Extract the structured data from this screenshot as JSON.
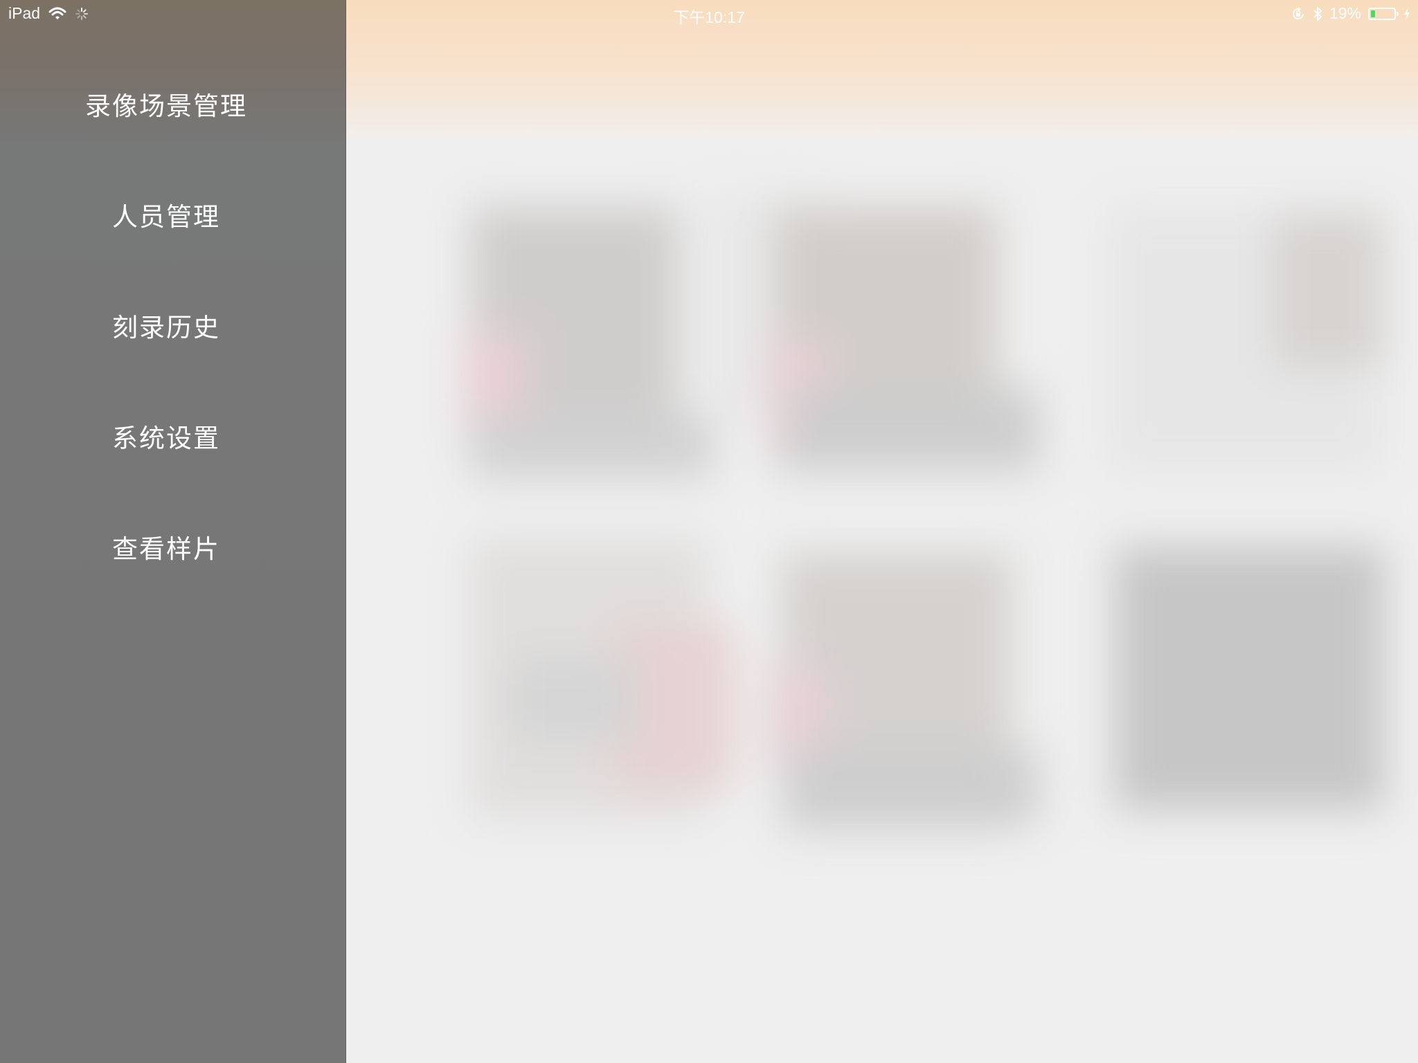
{
  "status_bar": {
    "device": "iPad",
    "time": "下午10:17",
    "battery_percent_text": "19%",
    "battery_level": 0.19,
    "icons": [
      "wifi-icon",
      "activity-spinner-icon",
      "rotation-lock-icon",
      "bluetooth-icon",
      "battery-icon",
      "charging-bolt-icon"
    ]
  },
  "sidebar": {
    "items": [
      {
        "label": "录像场景管理"
      },
      {
        "label": "人员管理"
      },
      {
        "label": "刻录历史"
      },
      {
        "label": "系统设置"
      },
      {
        "label": "查看样片"
      }
    ]
  },
  "colors": {
    "sidebar_bg": "#767676",
    "header_tint": "#f8dcbd",
    "main_bg": "#efefef",
    "battery_fill": "#4cd964"
  }
}
